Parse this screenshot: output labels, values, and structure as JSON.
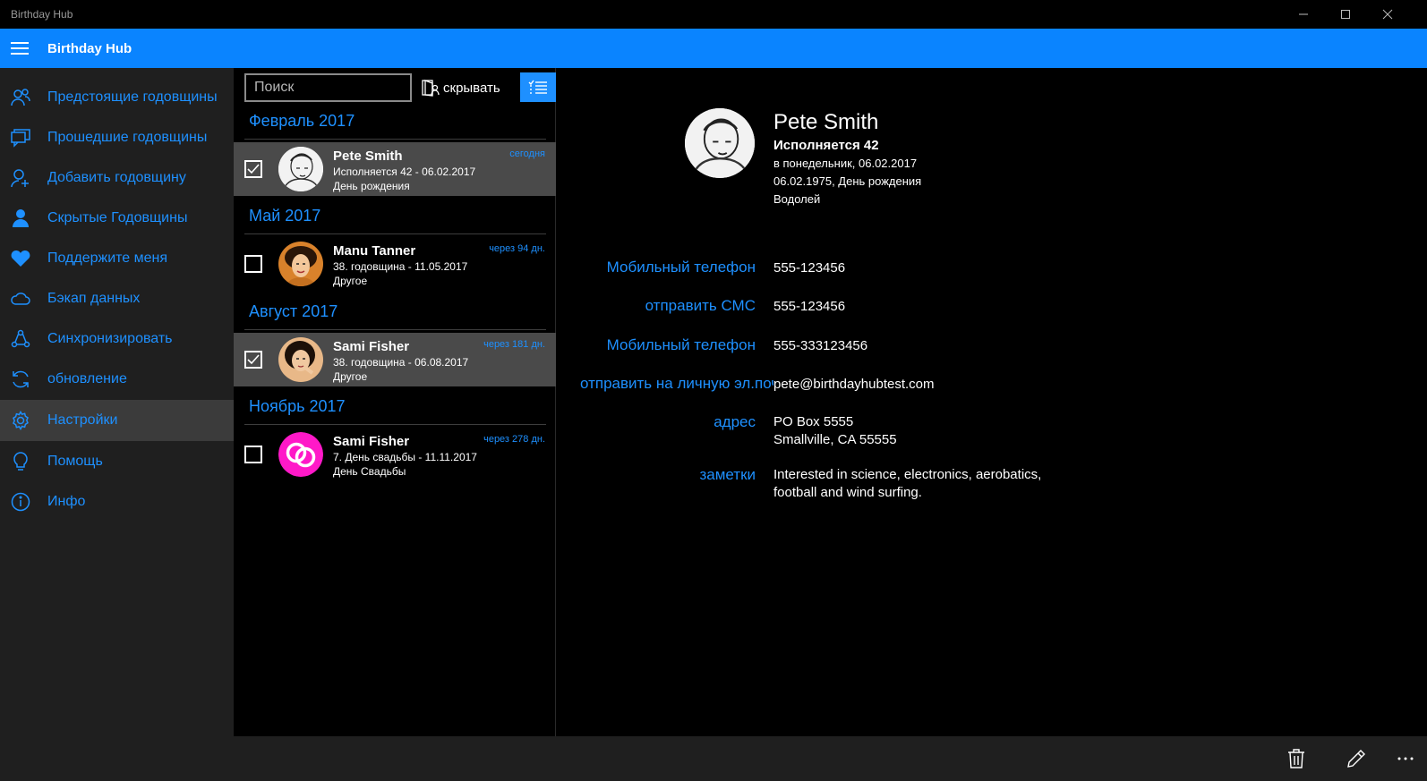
{
  "window": {
    "title": "Birthday Hub"
  },
  "appbar": {
    "title": "Birthday Hub"
  },
  "nav": {
    "items": [
      {
        "label": "Предстоящие годовщины",
        "icon": "people-icon"
      },
      {
        "label": "Прошедшие годовщины",
        "icon": "chat-icon"
      },
      {
        "label": "Добавить годовщину",
        "icon": "add-person-icon"
      },
      {
        "label": "Скрытые Годовщины",
        "icon": "person-icon"
      },
      {
        "label": "Поддержите меня",
        "icon": "heart-icon"
      },
      {
        "label": "Бэкап данных",
        "icon": "cloud-icon"
      },
      {
        "label": "Синхронизировать",
        "icon": "sync-icon"
      },
      {
        "label": "обновление",
        "icon": "refresh-icon"
      },
      {
        "label": "Настройки",
        "icon": "gear-icon"
      },
      {
        "label": "Помощь",
        "icon": "lightbulb-icon"
      },
      {
        "label": "Инфо",
        "icon": "info-icon"
      }
    ],
    "selected": "Настройки"
  },
  "list": {
    "search_placeholder": "Поиск",
    "hide_label": "скрывать",
    "groups": [
      {
        "header": "Февраль 2017",
        "name": "Pete Smith",
        "line1": "Исполняется 42 - 06.02.2017",
        "line2": "День рождения",
        "when": "сегодня",
        "checked": true
      },
      {
        "header": "Май 2017",
        "name": "Manu Tanner",
        "line1": "38. годовщина - 11.05.2017",
        "line2": "Другое",
        "when": "через 94 дн.",
        "checked": false
      },
      {
        "header": "Август 2017",
        "name": "Sami Fisher",
        "line1": "38. годовщина - 06.08.2017",
        "line2": "Другое",
        "when": "через 181 дн.",
        "checked": true
      },
      {
        "header": "Ноябрь 2017",
        "name": "Sami Fisher",
        "line1": "7. День свадьбы - 11.11.2017",
        "line2": "День Свадьбы",
        "when": "через 278 дн.",
        "checked": false
      }
    ]
  },
  "detail": {
    "name": "Pete Smith",
    "turning": "Исполняется 42",
    "date_line": "в понедельник, 06.02.2017",
    "birth_line": "06.02.1975, День рождения",
    "zodiac": "Водолей",
    "fields": [
      {
        "label": "Мобильный телефон",
        "value": "555-123456"
      },
      {
        "label": "отправить СМС",
        "value": "555-123456"
      },
      {
        "label": "Мобильный телефон",
        "value": "555-333123456"
      },
      {
        "label": "отправить на личную эл.почту",
        "value": "pete@birthdayhubtest.com"
      }
    ],
    "address_label": "адрес",
    "address_line1": "PO Box 5555",
    "address_line2": "Smallville, CA 55555",
    "notes_label": "заметки",
    "notes_line1": "Interested in science, electronics, aerobatics,",
    "notes_line2": "football and wind surfing."
  },
  "colors": {
    "accent": "#0a84ff",
    "link": "#1e90ff",
    "sidebar": "#1f1f1f",
    "selected_row": "#4a4a4a"
  }
}
